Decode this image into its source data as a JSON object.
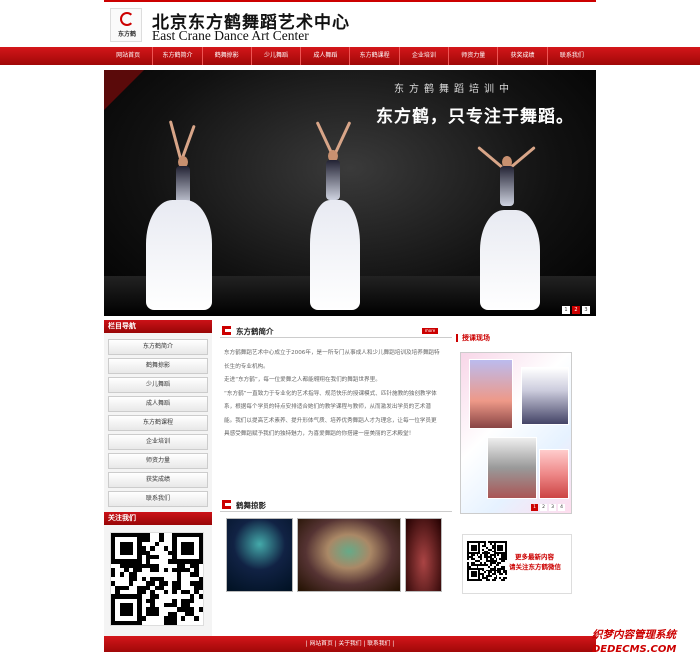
{
  "header": {
    "logo_text": "东方鹤",
    "title_cn": "北京东方鹤舞蹈艺术中心",
    "title_en": "East Crane Dance Art Center"
  },
  "nav": {
    "items": [
      "网站首页",
      "东方鹤简介",
      "鹤舞掠影",
      "少儿舞蹈",
      "成人舞蹈",
      "东方鹤课程",
      "企业培训",
      "师资力量",
      "获奖成绩",
      "联系我们"
    ]
  },
  "banner": {
    "subtitle": "东方鹤舞蹈培训中",
    "headline": "东方鹤，只专注于舞蹈。",
    "dots": [
      "1",
      "2",
      "3"
    ],
    "active_dot": 1
  },
  "sidebar": {
    "title": "栏目导航",
    "items": [
      "东方鹤简介",
      "鹤舞掠影",
      "少儿舞蹈",
      "成人舞蹈",
      "东方鹤课程",
      "企业培训",
      "师资力量",
      "获奖成绩",
      "联系我们"
    ],
    "follow_title": "关注我们"
  },
  "intro": {
    "title": "东方鹤简介",
    "more": "more",
    "paragraphs": [
      "东方鹤舞蹈艺术中心成立于2006年，是一所专门从事成人和少儿舞蹈培训及培养舞蹈特长生的专业机构。",
      "走进“东方鹤”，每一位爱舞之人都能翱翔在我们的舞蹈世界里。",
      "“东方鹤”一直致力于专业化的艺术指导、规范快乐的授课模式、匹针施教的独创教学体系，根据每个学员的特点安排适合她们的教学课程与教师，从而激发出学员的艺术潜能。我们以提高艺术素养、提升形体气质、培养优秀舞蹈人才为理念，让每一位学员更具感受舞蹈赋予我们的独特魅力，为喜爱舞蹈的你搭建一座美丽的艺术殿堂！"
    ]
  },
  "photos": {
    "title": "鹤舞掠影"
  },
  "teaching": {
    "title": "授课现场",
    "dots": [
      "1",
      "2",
      "3",
      "4"
    ],
    "active_dot": 0
  },
  "promo": {
    "line1": "更多最新内容",
    "line2": "请关注东方鹤微信"
  },
  "footer": {
    "text": "| 网站首页 | 关于我们 | 联系我们 |"
  },
  "watermark": {
    "line1": "织梦内容管理系统",
    "line2": "DEDECMS.COM"
  },
  "colors": {
    "brand_red": "#c00000",
    "nav_red": "#d4161a"
  }
}
